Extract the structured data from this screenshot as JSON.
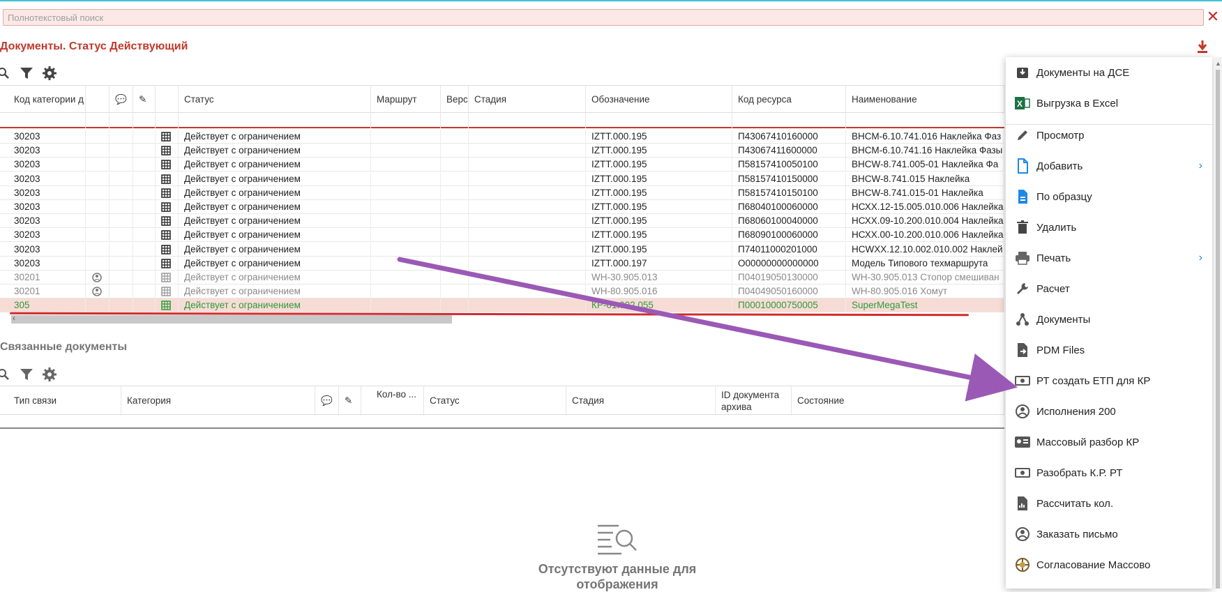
{
  "search": {
    "placeholder": "Полнотекстовый поиск"
  },
  "main": {
    "title": "Документы. Статус Действующий",
    "columns": [
      "Код категории д",
      "",
      "",
      "",
      "Статус",
      "Маршрут",
      "Верс",
      "Стадия",
      "Обозначение",
      "Код ресурса",
      "Наименование"
    ],
    "rows": [
      {
        "code": "30203",
        "status": "Действует с ограничением",
        "designation": "IZTT.000.195",
        "resource": "П43067410160000",
        "name": "ВНСМ-6.10.741.016 Наклейка  Фаз"
      },
      {
        "code": "30203",
        "status": "Действует с ограничением",
        "designation": "IZTT.000.195",
        "resource": "П43067411600000",
        "name": "ВНСМ-6.10.741.16 Наклейка Фазы"
      },
      {
        "code": "30203",
        "status": "Действует с ограничением",
        "designation": "IZTT.000.195",
        "resource": "П58157410050100",
        "name": "ВНСW-8.741.005-01 Наклейка  Фа"
      },
      {
        "code": "30203",
        "status": "Действует с ограничением",
        "designation": "IZTT.000.195",
        "resource": "П58157410150000",
        "name": "ВНСW-8.741.015 Наклейка"
      },
      {
        "code": "30203",
        "status": "Действует с ограничением",
        "designation": "IZTT.000.195",
        "resource": "П58157410150100",
        "name": "ВНСW-8.741.015-01 Наклейка"
      },
      {
        "code": "30203",
        "status": "Действует с ограничением",
        "designation": "IZTT.000.195",
        "resource": "П68040100060000",
        "name": "НСХХ.12-15.005.010.006 Наклейка"
      },
      {
        "code": "30203",
        "status": "Действует с ограничением",
        "designation": "IZTT.000.195",
        "resource": "П68060100040000",
        "name": "НСХХ.09-10.200.010.004 Наклейка"
      },
      {
        "code": "30203",
        "status": "Действует с ограничением",
        "designation": "IZTT.000.195",
        "resource": "П68090100060000",
        "name": "НСХХ.00-10.200.010.006 Наклейка"
      },
      {
        "code": "30203",
        "status": "Действует с ограничением",
        "designation": "IZTT.000.195",
        "resource": "П74011000201000",
        "name": "НСWХХ.12.10.002.010.002 Наклей"
      },
      {
        "code": "30203",
        "status": "Действует с ограничением",
        "designation": "IZTT.000.197",
        "resource": "О00000000000000",
        "name": "Модель Типового техмаршрута"
      },
      {
        "code": "30201",
        "status": "Действует с ограничением",
        "designation": "WH-30.905.013",
        "resource": "П04019050130000",
        "name": "WH-30.905.013 Стопор смешиван"
      },
      {
        "code": "30201",
        "status": "Действует с ограничением",
        "designation": "WH-80.905.016",
        "resource": "П04049050160000",
        "name": "WH-80.905.016 Хомут"
      },
      {
        "code": "305",
        "status": "Действует с ограничением",
        "designation": "КР-01.002.055",
        "resource": "П00010000750005",
        "name": "SuperMegaTest"
      }
    ]
  },
  "related": {
    "title": "Связанные документы",
    "columns": [
      "Тип связи",
      "Категория",
      "",
      "",
      "Кол-во ...",
      "Статус",
      "Стадия",
      "ID документа архива",
      "Состояние"
    ],
    "empty_text": "Отсутствуют данные для отображения"
  },
  "menu": {
    "items": [
      {
        "label": "Документы на ДСЕ",
        "icon": "archive-icon",
        "submenu": false
      },
      {
        "label": "Выгрузка в Excel",
        "icon": "excel-icon",
        "submenu": false
      },
      {
        "label": "Просмотр",
        "icon": "pencil-icon",
        "submenu": false
      },
      {
        "label": "Добавить",
        "icon": "new-file-icon",
        "submenu": true
      },
      {
        "label": "По образцу",
        "icon": "document-icon",
        "submenu": false
      },
      {
        "label": "Удалить",
        "icon": "trash-icon",
        "submenu": false
      },
      {
        "label": "Печать",
        "icon": "printer-icon",
        "submenu": true
      },
      {
        "label": "Расчет",
        "icon": "wrench-icon",
        "submenu": false
      },
      {
        "label": "Документы",
        "icon": "share-icon",
        "submenu": false
      },
      {
        "label": "PDM Files",
        "icon": "file-export-icon",
        "submenu": false
      },
      {
        "label": "РТ создать ЕТП для КР",
        "icon": "money-icon",
        "submenu": false
      },
      {
        "label": "Исполнения 200",
        "icon": "people-icon",
        "submenu": false
      },
      {
        "label": "Массовый разбор КР",
        "icon": "id-card-icon",
        "submenu": false
      },
      {
        "label": "Разобрать К.Р. РТ",
        "icon": "money-icon",
        "submenu": false
      },
      {
        "label": "Рассчитать кол.",
        "icon": "chart-file-icon",
        "submenu": false
      },
      {
        "label": "Заказать письмо",
        "icon": "people-icon",
        "submenu": false
      },
      {
        "label": "Согласование Массово",
        "icon": "aperture-icon",
        "submenu": false
      }
    ],
    "chevron": "›"
  },
  "colors": {
    "accent": "#c0392b",
    "selected_text": "#2e9a3a",
    "link_blue": "#1e88e5",
    "annotation_arrow": "#9b59b6"
  }
}
